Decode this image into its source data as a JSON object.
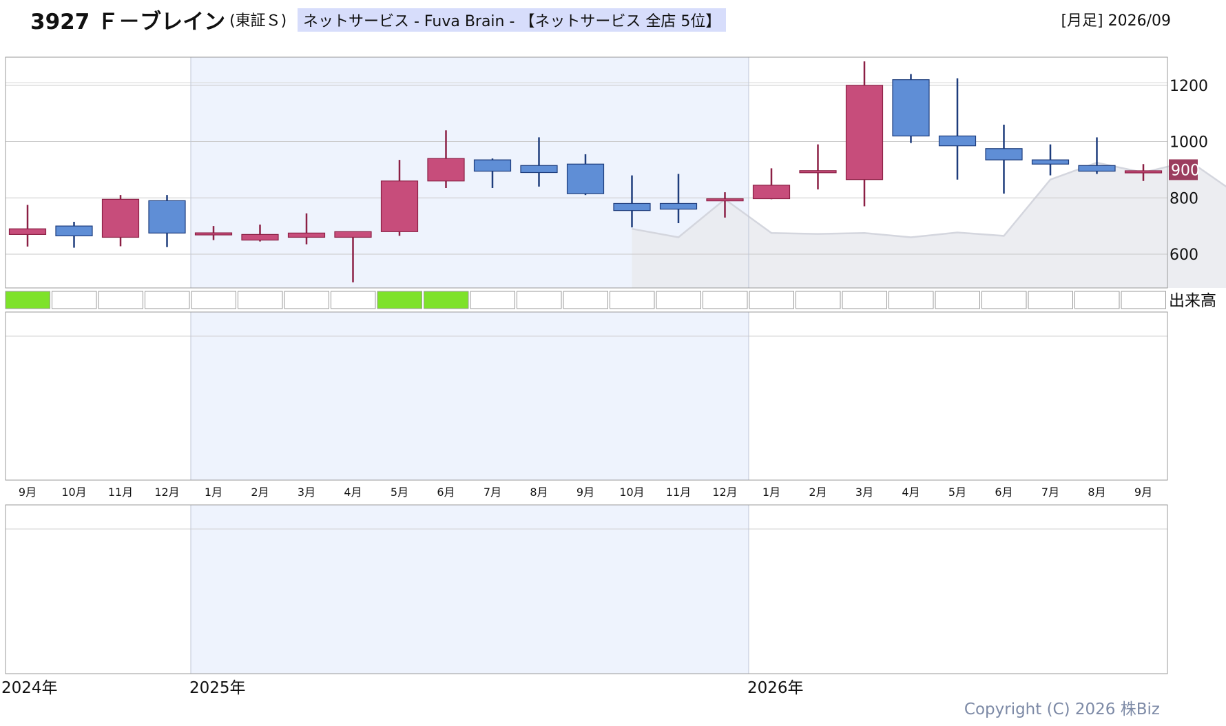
{
  "header": {
    "code_name": "3927 Ｆ－ブレイン",
    "market": "(東証Ｓ)",
    "sector_info": "ネットサービス - Fuva Brain - 【ネットサービス 全店 5位】",
    "period": "[月足] 2026/09"
  },
  "volume_label": "出来高",
  "copyright": "Copyright (C) 2026 株Biz",
  "colors": {
    "up": "#c74d7b",
    "down": "#5f8ed6",
    "up_wick": "#8b1f44",
    "down_wick": "#1d3c7c",
    "highlight_band": "#eef3fd",
    "ma_fill": "#e9eaee",
    "ma_line": "#d4d6de",
    "price_badge": "#9b3d5e",
    "signal_green": "#7ee22a"
  },
  "chart_data": {
    "type": "candlestick",
    "x": [
      "9月",
      "10月",
      "11月",
      "12月",
      "1月",
      "2月",
      "3月",
      "4月",
      "5月",
      "6月",
      "7月",
      "8月",
      "9月",
      "10月",
      "11月",
      "12月",
      "1月",
      "2月",
      "3月",
      "4月",
      "5月",
      "6月",
      "7月",
      "8月",
      "9月"
    ],
    "years": [
      {
        "label": "2024年",
        "start_index": 0
      },
      {
        "label": "2025年",
        "start_index": 4
      },
      {
        "label": "2026年",
        "start_index": 16
      }
    ],
    "series": [
      {
        "open": [
          670,
          700,
          660,
          790,
          672,
          650,
          660,
          660,
          680,
          860,
          935,
          915,
          920,
          780,
          780,
          793,
          797,
          893,
          865,
          1220,
          1020,
          975,
          935,
          915,
          890
        ],
        "high": [
          775,
          715,
          810,
          810,
          700,
          705,
          745,
          680,
          935,
          1040,
          940,
          1015,
          955,
          880,
          885,
          820,
          905,
          990,
          1285,
          1240,
          1225,
          1060,
          990,
          1015,
          920
        ],
        "low": [
          627,
          623,
          628,
          625,
          650,
          645,
          635,
          500,
          665,
          835,
          835,
          840,
          810,
          695,
          710,
          730,
          795,
          830,
          770,
          995,
          865,
          815,
          880,
          885,
          860
        ],
        "close": [
          690,
          665,
          795,
          675,
          672,
          670,
          675,
          680,
          860,
          940,
          895,
          890,
          815,
          755,
          760,
          793,
          845,
          893,
          1200,
          1020,
          985,
          935,
          920,
          895,
          895
        ]
      }
    ],
    "moving_average": {
      "start_index": 13,
      "values": [
        690,
        660,
        795,
        675,
        672,
        675,
        660,
        677,
        665,
        865,
        925,
        890,
        930,
        815
      ]
    },
    "volume_flags": [
      true,
      false,
      false,
      false,
      false,
      false,
      false,
      false,
      true,
      true,
      false,
      false,
      false,
      false,
      false,
      false,
      false,
      false,
      false,
      false,
      false,
      false,
      false,
      false,
      false
    ],
    "y_ticks": [
      600,
      800,
      1000,
      1200
    ],
    "ylim": [
      480,
      1300
    ],
    "last_price": 900,
    "highlight_range": [
      4,
      15
    ]
  }
}
